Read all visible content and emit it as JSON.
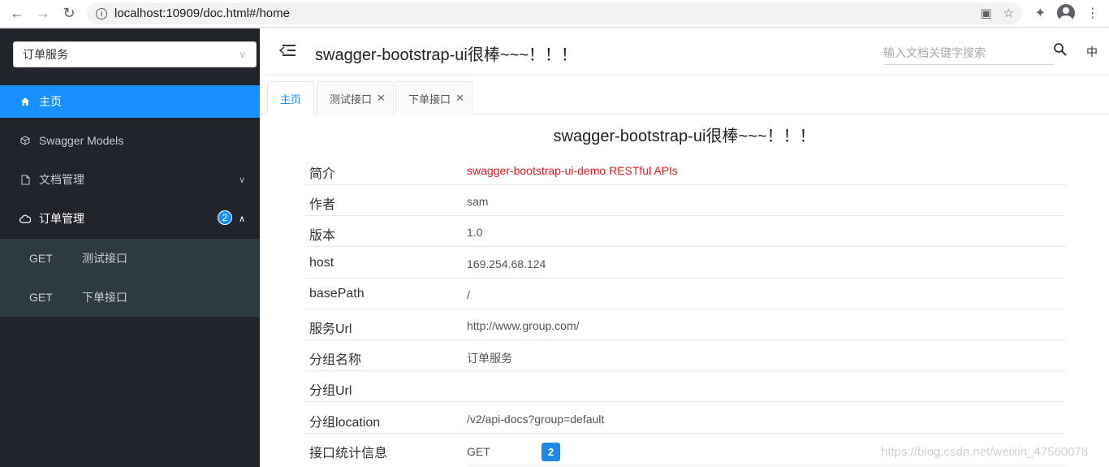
{
  "browser": {
    "url": "localhost:10909/doc.html#/home",
    "icons": [
      "back-arrow-icon",
      "forward-arrow-icon",
      "reload-icon",
      "info-icon",
      "translate-icon",
      "star-icon",
      "extensions-icon",
      "account-icon",
      "more-icon"
    ]
  },
  "sidebar": {
    "group_select": "订单服务",
    "items": [
      {
        "label": "主页",
        "icon": "home-icon"
      },
      {
        "label": "Swagger Models",
        "icon": "cube-icon"
      },
      {
        "label": "文档管理",
        "icon": "document-icon"
      },
      {
        "label": "订单管理",
        "icon": "cloud-icon",
        "badge": "2"
      }
    ],
    "subitems": [
      {
        "method": "GET",
        "name": "测试接口"
      },
      {
        "method": "GET",
        "name": "下单接口"
      }
    ]
  },
  "header": {
    "title": "swagger-bootstrap-ui很棒~~~！！！",
    "search_placeholder": "输入文档关键字搜索",
    "lang": "中"
  },
  "tabs": [
    {
      "label": "主页",
      "closable": false
    },
    {
      "label": "测试接口",
      "closable": true
    },
    {
      "label": "下单接口",
      "closable": true
    }
  ],
  "main": {
    "title": "swagger-bootstrap-ui很棒~~~！！！",
    "rows": [
      {
        "label": "简介",
        "value": "swagger-bootstrap-ui-demo RESTful APIs"
      },
      {
        "label": "作者",
        "value": "sam"
      },
      {
        "label": "版本",
        "value": "1.0"
      },
      {
        "label": "host",
        "value": "169.254.68.124"
      },
      {
        "label": "basePath",
        "value": "/"
      },
      {
        "label": "服务Url",
        "value": "http://www.group.com/"
      },
      {
        "label": "分组名称",
        "value": "订单服务"
      },
      {
        "label": "分组Url",
        "value": ""
      },
      {
        "label": "分组location",
        "value": "/v2/api-docs?group=default"
      },
      {
        "label": "接口统计信息",
        "value": ""
      }
    ],
    "stats": {
      "method": "GET",
      "count": "2"
    },
    "watermark": "https://blog.csdn.net/weixin_47560078"
  },
  "colors": {
    "accent": "#1890ff",
    "sidebar_bg": "#21252b",
    "highlight_red": "#e8181c"
  }
}
